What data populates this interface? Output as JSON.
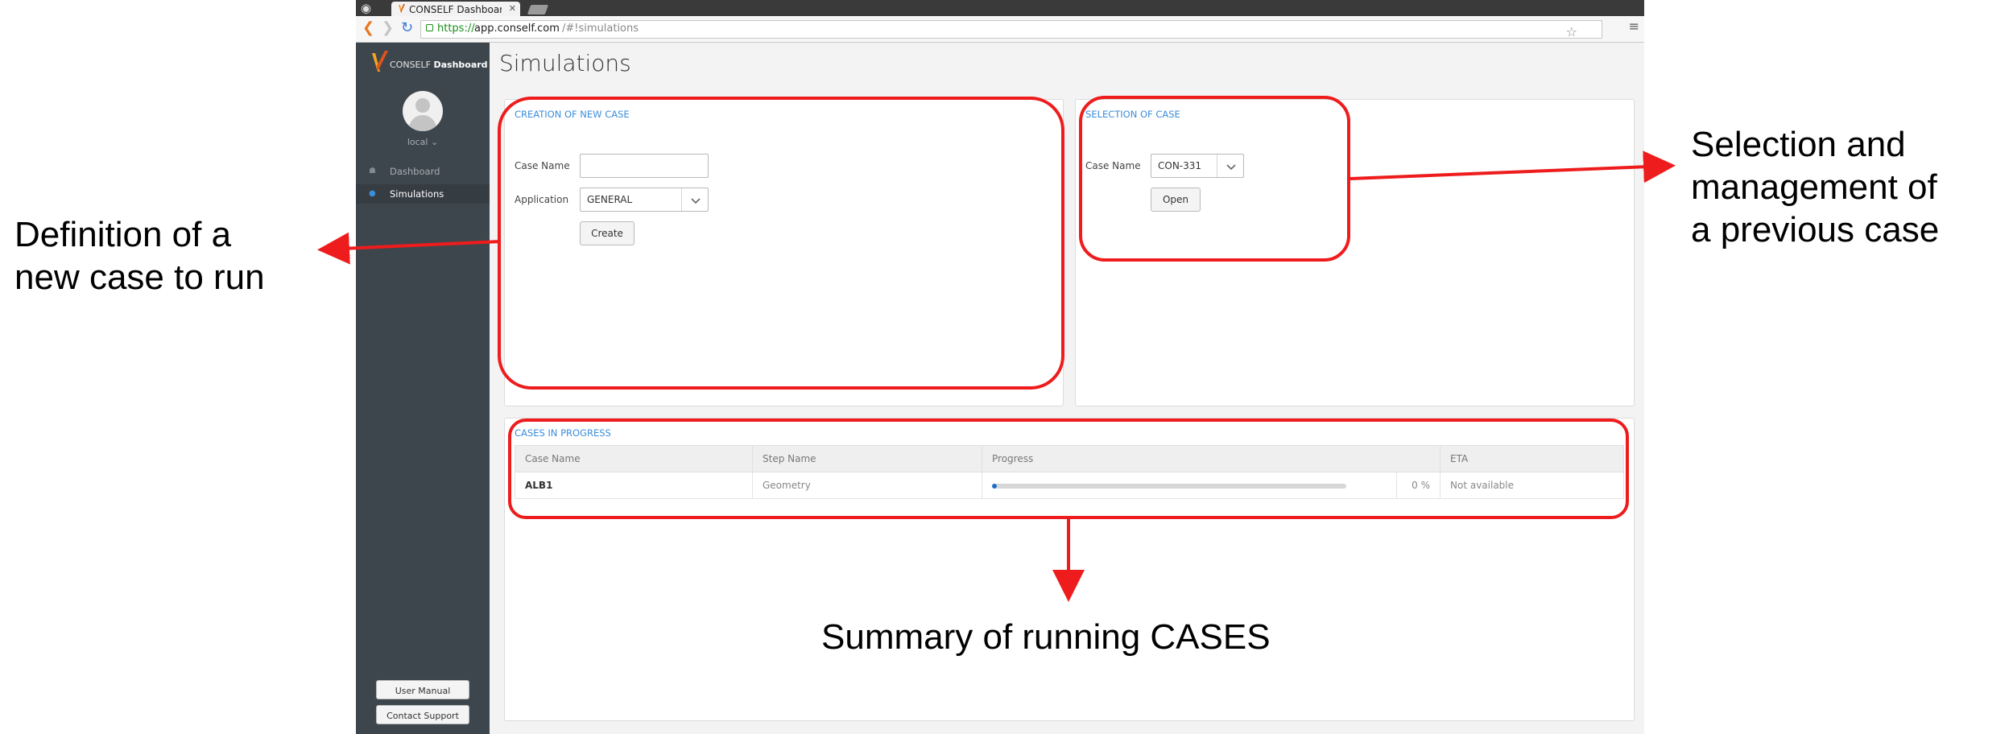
{
  "browser": {
    "tab_title": "CONSELF Dashboard",
    "url_scheme": "https://",
    "url_host": "app.conself.com",
    "url_path": "/#!simulations"
  },
  "sidebar": {
    "brand_prefix": "CONSELF",
    "brand_bold": "Dashboard",
    "user": "local ⌄",
    "items": [
      {
        "label": "Dashboard",
        "icon": "home-icon"
      },
      {
        "label": "Simulations",
        "icon": "simulations-icon",
        "active": true
      }
    ],
    "user_manual_label": "User Manual",
    "contact_support_label": "Contact Support"
  },
  "main": {
    "title": "Simulations",
    "create_panel": {
      "title": "CREATION OF NEW CASE",
      "case_name_label": "Case Name",
      "case_name_value": "",
      "application_label": "Application",
      "application_value": "GENERAL",
      "create_label": "Create"
    },
    "select_panel": {
      "title": "SELECTION OF CASE",
      "case_name_label": "Case Name",
      "case_name_value": "CON-331",
      "open_label": "Open"
    },
    "progress_panel": {
      "title": "CASES IN PROGRESS",
      "columns": [
        "Case Name",
        "Step Name",
        "Progress",
        "",
        "ETA"
      ],
      "rows": [
        {
          "case_name": "ALB1",
          "step_name": "Geometry",
          "progress": 0,
          "progress_text": "0 %",
          "eta": "Not available"
        }
      ]
    }
  },
  "annotations": {
    "left": [
      "Definition of a",
      "new case to run"
    ],
    "right": [
      "Selection and",
      "management of",
      "a previous case"
    ],
    "bottom": "Summary of running CASES",
    "color": "#ee1c1c"
  }
}
